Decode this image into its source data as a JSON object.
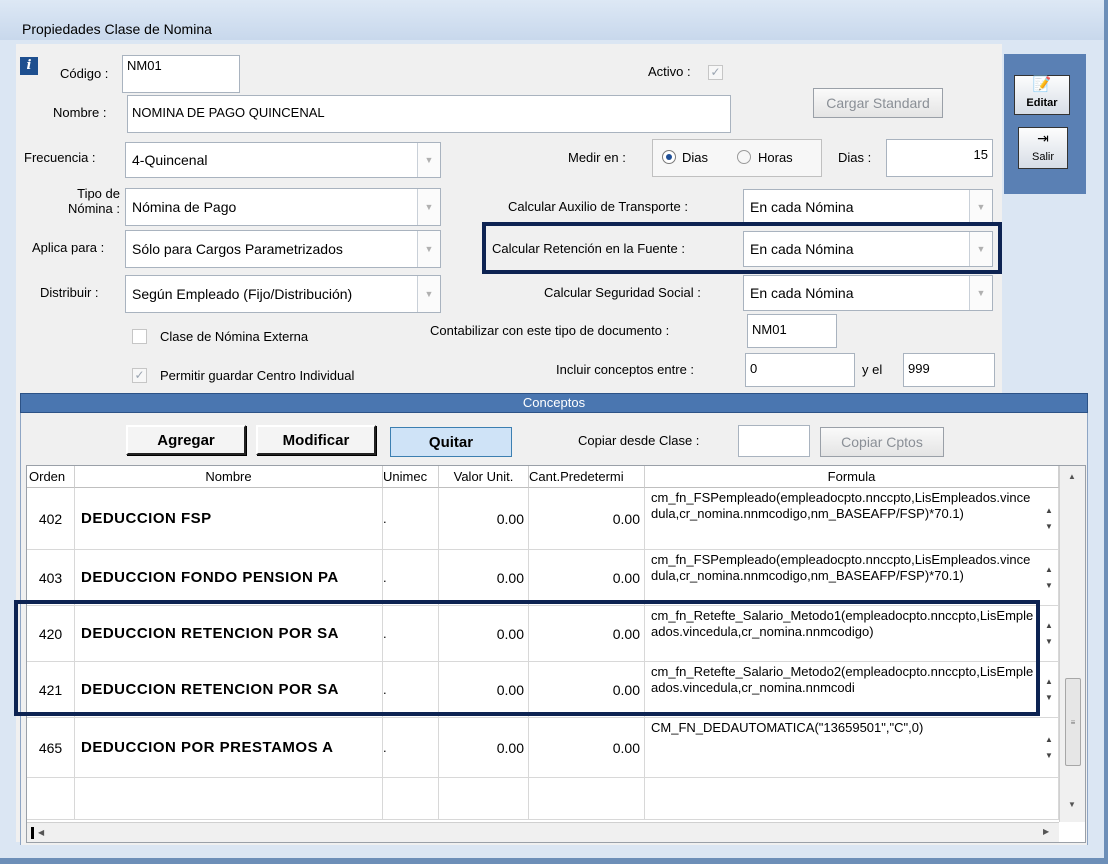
{
  "window": {
    "title": "Propiedades Clase de Nomina"
  },
  "icons": {
    "info": "info-icon",
    "edit": "edit-icon",
    "exit": "exit-icon"
  },
  "form": {
    "codigo_label": "Código :",
    "codigo_value": "NM01",
    "activo_label": "Activo :",
    "nombre_label": "Nombre :",
    "nombre_value": "NOMINA DE PAGO QUINCENAL",
    "cargar_standard": "Cargar Standard",
    "frecuencia_label": "Frecuencia :",
    "frecuencia_value": "4-Quincenal",
    "medir_label": "Medir en :",
    "medir_dias": "Dias",
    "medir_horas": "Horas",
    "dias_label": "Dias :",
    "dias_value": "15",
    "tipo_label_1": "Tipo de",
    "tipo_label_2": "Nómina :",
    "tipo_value": "Nómina de Pago",
    "aux_transporte_label": "Calcular Auxilio de Transporte :",
    "aux_transporte_value": "En cada Nómina",
    "aplica_label": "Aplica para :",
    "aplica_value": "Sólo para Cargos Parametrizados",
    "retencion_label": "Calcular Retención en la Fuente :",
    "retencion_value": "En cada Nómina",
    "distribuir_label": "Distribuir :",
    "distribuir_value": "Según Empleado (Fijo/Distribución)",
    "seguridad_label": "Calcular Seguridad Social :",
    "seguridad_value": "En cada Nómina",
    "externa_label": "Clase de Nómina Externa",
    "contabilizar_label": "Contabilizar con este tipo de documento :",
    "contabilizar_value": "NM01",
    "permitir_label": "Permitir guardar Centro Individual",
    "incluir_label": "Incluir conceptos entre :",
    "incluir_from": "0",
    "incluir_y": "y el",
    "incluir_to": "999"
  },
  "toolbar": {
    "editar": "Editar",
    "salir": "Salir"
  },
  "conceptos": {
    "header": "Conceptos",
    "agregar": "Agregar",
    "modificar": "Modificar",
    "quitar": "Quitar",
    "copiar_label": "Copiar desde Clase :",
    "copiar_value": "",
    "copiar_btn": "Copiar Cptos"
  },
  "grid": {
    "columns": [
      "Orden",
      "Nombre",
      "Unimec",
      "Valor Unit.",
      "Cant.Predetermi",
      "Formula"
    ],
    "rows": [
      {
        "orden": "402",
        "nombre": "DEDUCCION FSP",
        "unimed": ".",
        "valor": "0.00",
        "cant": "0.00",
        "formula": "cm_fn_FSPempleado(empleadocpto.nnccpto,LisEmpleados.vincedula,cr_nomina.nnmcodigo,nm_BASEAFP/FSP)*70.1)"
      },
      {
        "orden": "403",
        "nombre": "DEDUCCION FONDO PENSION PA",
        "unimed": ".",
        "valor": "0.00",
        "cant": "0.00",
        "formula": "cm_fn_FSPempleado(empleadocpto.nnccpto,LisEmpleados.vincedula,cr_nomina.nnmcodigo,nm_BASEAFP/FSP)*70.1)"
      },
      {
        "orden": "420",
        "nombre": "DEDUCCION RETENCION POR SA",
        "unimed": ".",
        "valor": "0.00",
        "cant": "0.00",
        "formula": "cm_fn_Retefte_Salario_Metodo1(empleadocpto.nnccpto,LisEmpleados.vincedula,cr_nomina.nnmcodigo)"
      },
      {
        "orden": "421",
        "nombre": "DEDUCCION RETENCION POR SA",
        "unimed": ".",
        "valor": "0.00",
        "cant": "0.00",
        "formula": "cm_fn_Retefte_Salario_Metodo2(empleadocpto.nnccpto,LisEmpleados.vincedula,cr_nomina.nnmcodi"
      },
      {
        "orden": "465",
        "nombre": "DEDUCCION POR PRESTAMOS A",
        "unimed": ".",
        "valor": "0.00",
        "cant": "0.00",
        "formula": "CM_FN_DEDAUTOMATICA(\"13659501\",\"C\",0)"
      }
    ]
  },
  "colors": {
    "highlight": "#0d2352",
    "section_bar": "#4a76b0",
    "window_bg": "#dbe6f3"
  }
}
